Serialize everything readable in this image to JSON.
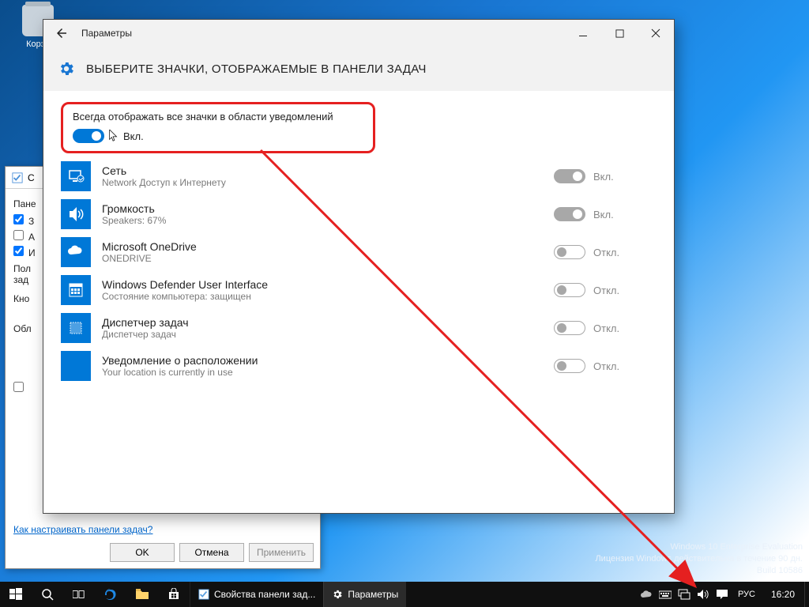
{
  "desktop": {
    "recycle_bin": "Корзи"
  },
  "watermark": {
    "line1": "Windows 10 Enterprise Evaluation",
    "line2": "Лицензия Windows действительна в течение 90 дн.",
    "line3": "Build 10586"
  },
  "props_window": {
    "title_prefix": "С",
    "tab": "Пане",
    "cb1": "З",
    "cb2": "А",
    "cb3": "И",
    "label_pol": "Пол",
    "label_zad": "зад",
    "label_kno": "Кно",
    "label_obl": "Обл",
    "cb4": "",
    "link": "Как настраивать панели задач?",
    "btn_ok": "OK",
    "btn_cancel": "Отмена",
    "btn_apply": "Применить"
  },
  "settings": {
    "titlebar": "Параметры",
    "header": "ВЫБЕРИТЕ ЗНАЧКИ, ОТОБРАЖАЕМЫЕ В ПАНЕЛИ ЗАДАЧ",
    "master_label": "Всегда отображать все значки в области уведомлений",
    "master_state": "Вкл.",
    "status_on": "Вкл.",
    "status_off": "Откл.",
    "rows": [
      {
        "title": "Сеть",
        "sub": "Network Доступ к Интернету",
        "on": true
      },
      {
        "title": "Громкость",
        "sub": "Speakers: 67%",
        "on": true
      },
      {
        "title": "Microsoft OneDrive",
        "sub": "ONEDRIVE",
        "on": false
      },
      {
        "title": "Windows Defender User Interface",
        "sub": "Состояние компьютера: защищен",
        "on": false
      },
      {
        "title": "Диспетчер задач",
        "sub": "Диспетчер задач",
        "on": false
      },
      {
        "title": "Уведомление о расположении",
        "sub": "Your location is currently in use",
        "on": false
      }
    ]
  },
  "taskbar": {
    "app1": "Свойства панели зад...",
    "app2": "Параметры",
    "lang": "РУС",
    "clock": "16:20"
  }
}
